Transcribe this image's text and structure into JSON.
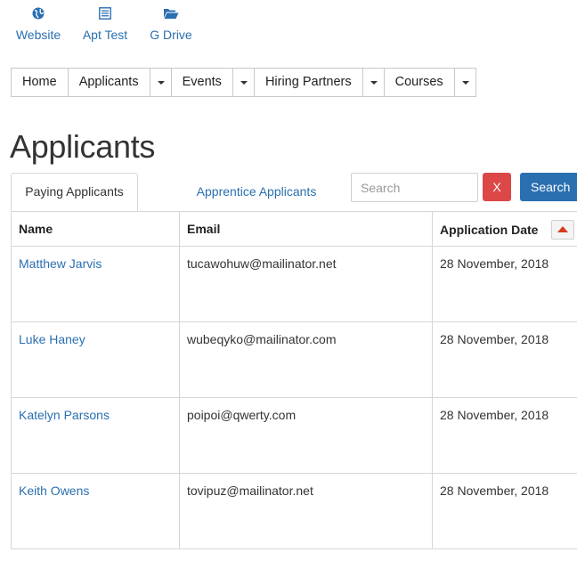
{
  "top_links": [
    {
      "label": "Website",
      "icon": "globe-icon"
    },
    {
      "label": "Apt Test",
      "icon": "list-icon"
    },
    {
      "label": "G Drive",
      "icon": "folder-open-icon"
    }
  ],
  "nav": {
    "home": "Home",
    "applicants": "Applicants",
    "events": "Events",
    "hiring_partners": "Hiring Partners",
    "courses": "Courses"
  },
  "page_title": "Applicants",
  "tabs": {
    "paying": "Paying Applicants",
    "apprentice": "Apprentice Applicants"
  },
  "search": {
    "placeholder": "Search",
    "value": "",
    "clear_label": "X",
    "button_label": "Search"
  },
  "table": {
    "columns": [
      "Name",
      "Email",
      "Application Date"
    ],
    "sort": {
      "column": "Application Date",
      "direction": "ascending"
    },
    "rows": [
      {
        "name": "Matthew Jarvis",
        "email": "tucawohuw@mailinator.net",
        "date": "28 November, 2018"
      },
      {
        "name": "Luke Haney",
        "email": "wubeqyko@mailinator.com",
        "date": "28 November, 2018"
      },
      {
        "name": "Katelyn Parsons",
        "email": "poipoi@qwerty.com",
        "date": "28 November, 2018"
      },
      {
        "name": "Keith Owens",
        "email": "tovipuz@mailinator.net",
        "date": "28 November, 2018"
      }
    ]
  },
  "colors": {
    "link": "#2a6fb0",
    "danger": "#dc4848",
    "primary": "#2a6fb0",
    "sort_arrow": "#d73a1f"
  }
}
